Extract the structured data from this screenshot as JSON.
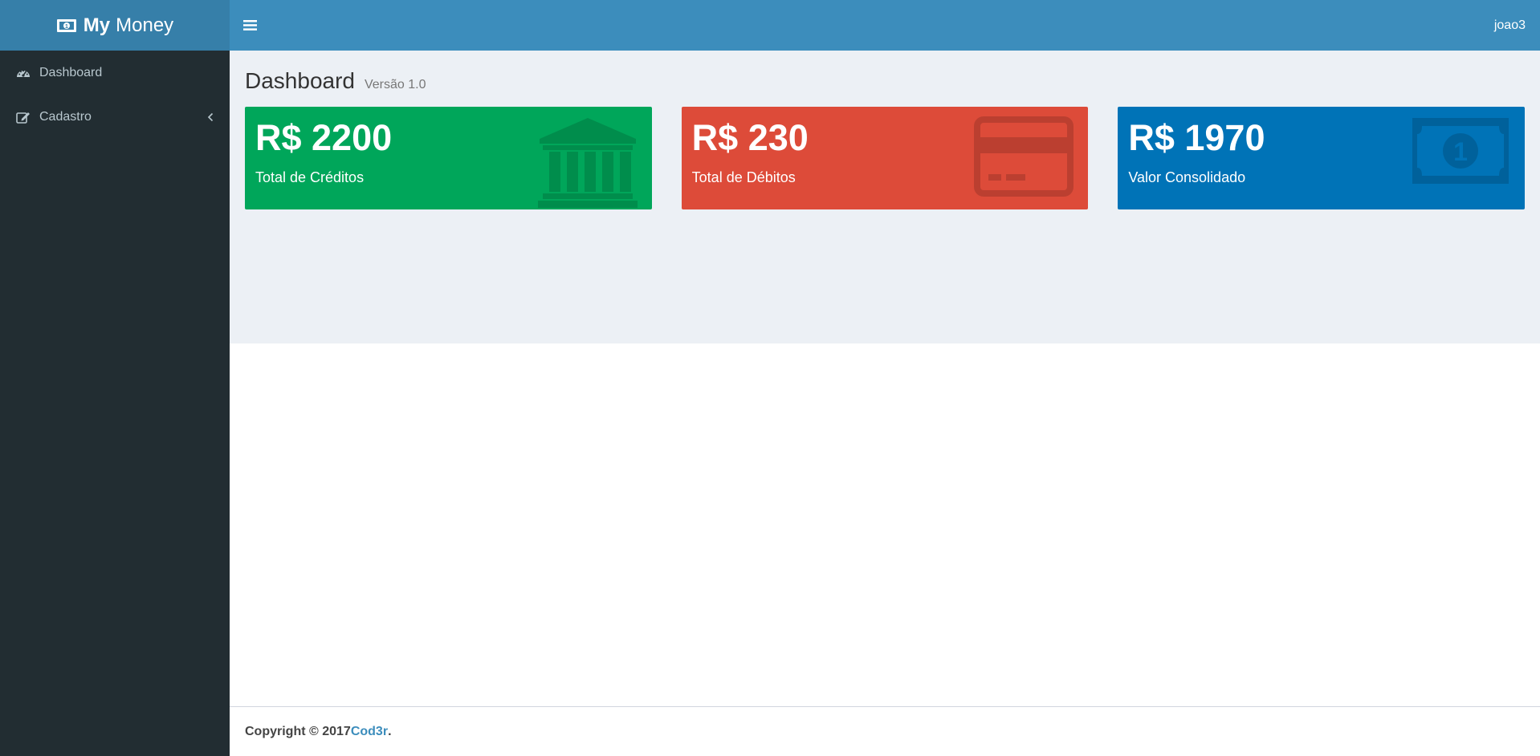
{
  "app": {
    "logo_bold": "My",
    "logo_light": "Money"
  },
  "sidebar": {
    "items": [
      {
        "label": "Dashboard",
        "icon": "dashboard-icon"
      },
      {
        "label": "Cadastro",
        "icon": "edit-icon",
        "has_submenu": true
      }
    ]
  },
  "navbar": {
    "user": "joao3"
  },
  "header": {
    "title": "Dashboard",
    "subtitle": "Versão 1.0"
  },
  "summary": {
    "credits": {
      "value": "R$ 2200",
      "label": "Total de Créditos",
      "color": "#00a65a",
      "icon": "bank-icon"
    },
    "debits": {
      "value": "R$ 230",
      "label": "Total de Débitos",
      "color": "#dd4b39",
      "icon": "credit-card-icon"
    },
    "consolidated": {
      "value": "R$ 1970",
      "label": "Valor Consolidado",
      "color": "#0073b7",
      "icon": "money-icon"
    }
  },
  "footer": {
    "prefix": "Copyright © 2017 ",
    "link": "Cod3r",
    "suffix": "."
  },
  "colors": {
    "sidebar_bg": "#222d32",
    "logo_bg": "#367fa9",
    "navbar_bg": "#3c8dbc",
    "content_bg": "#ecf0f5"
  }
}
